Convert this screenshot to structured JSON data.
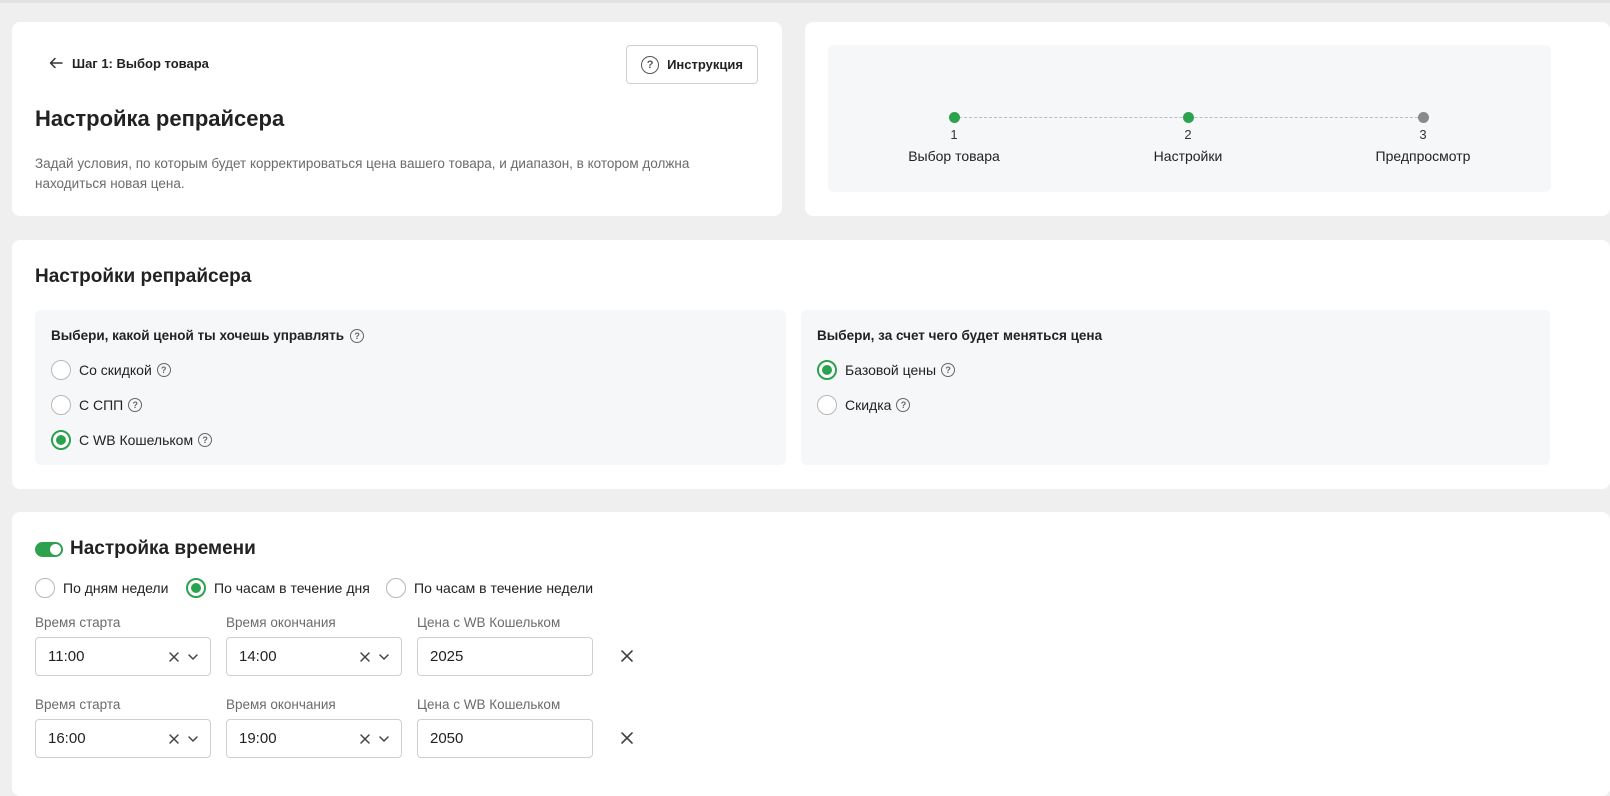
{
  "header": {
    "back_label": "Шаг 1: Выбор товара",
    "instruction_label": "Инструкция",
    "title": "Настройка репрайсера",
    "description": "Задай условия, по которым будет корректироваться цена вашего товара, и диапазон, в котором должна находиться новая цена."
  },
  "stepper": {
    "steps": [
      {
        "num": "1",
        "label": "Выбор товара",
        "status": "done"
      },
      {
        "num": "2",
        "label": "Настройки",
        "status": "current"
      },
      {
        "num": "3",
        "label": "Предпросмотр",
        "status": "pending"
      }
    ]
  },
  "settings": {
    "title": "Настройки репрайсера",
    "price_type": {
      "title": "Выбери, какой ценой ты хочешь управлять",
      "options": [
        {
          "label": "Со скидкой",
          "selected": false
        },
        {
          "label": "С СПП",
          "selected": false
        },
        {
          "label": "С WB Кошельком",
          "selected": true
        }
      ]
    },
    "change_by": {
      "title": "Выбери, за счет чего будет меняться цена",
      "options": [
        {
          "label": "Базовой цены",
          "selected": true
        },
        {
          "label": "Скидка",
          "selected": false
        }
      ]
    }
  },
  "time": {
    "title": "Настройка времени",
    "enabled": true,
    "modes": [
      {
        "label": "По дням недели",
        "selected": false
      },
      {
        "label": "По часам в течение дня",
        "selected": true
      },
      {
        "label": "По часам в течение недели",
        "selected": false
      }
    ],
    "labels": {
      "start": "Время старта",
      "end": "Время окончания",
      "price": "Цена с WB Кошельком"
    },
    "rows": [
      {
        "start": "11:00",
        "end": "14:00",
        "price": "2025"
      },
      {
        "start": "16:00",
        "end": "19:00",
        "price": "2050"
      }
    ]
  },
  "colors": {
    "accent": "#2ca24f",
    "pending": "#8a8a8a",
    "background": "#efefef",
    "panel": "#f6f7f8"
  }
}
